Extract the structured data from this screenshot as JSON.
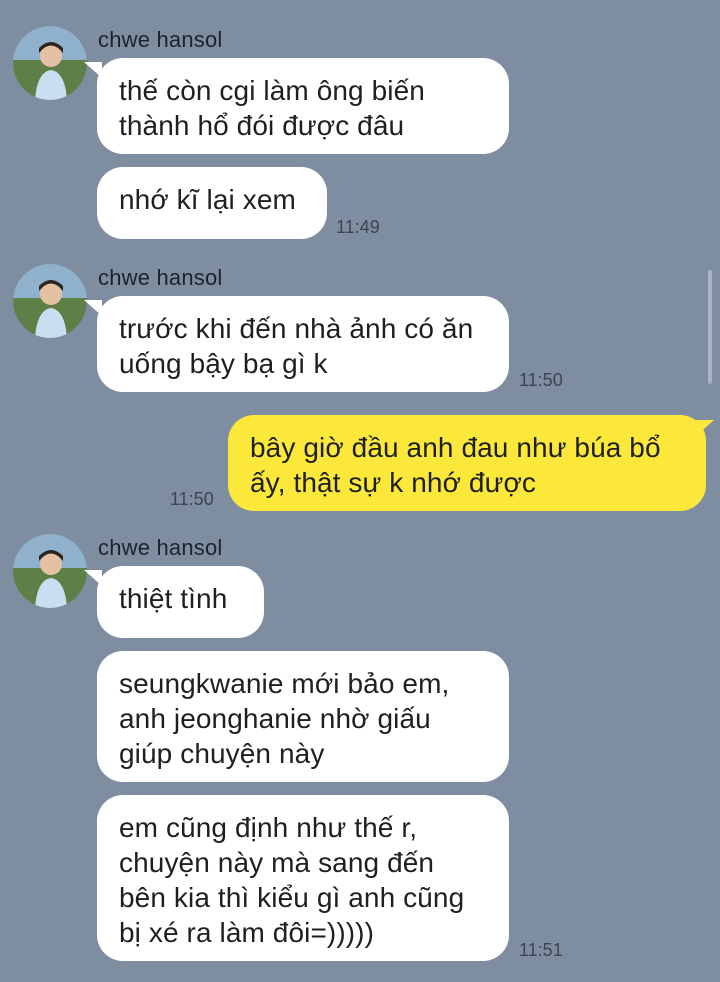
{
  "conversation": {
    "groups": [
      {
        "sender": "chwe hansol",
        "messages": [
          "thế còn cgi làm ông biến\nthành hổ đói được đâu",
          "nhớ kĩ lại xem"
        ],
        "time": "11:49"
      },
      {
        "sender": "chwe hansol",
        "messages": [
          "trước khi đến nhà ảnh có ăn\nuống bậy bạ gì k"
        ],
        "time": "11:50"
      },
      {
        "mine": true,
        "messages": [
          "bây giờ đầu anh đau như búa bổ\nấy, thật sự k nhớ được"
        ],
        "time": "11:50"
      },
      {
        "sender": "chwe hansol",
        "messages": [
          "thiệt tình",
          "seungkwanie mới bảo em,\nanh jeonghanie nhờ giấu\ngiúp chuyện này",
          "em cũng định như thế r,\nchuyện này mà sang đến\nbên kia thì kiểu gì anh cũng\nbị xé ra làm đôi=)))))"
        ],
        "time": "11:51"
      }
    ]
  },
  "colors": {
    "background": "#7f8da1",
    "incoming_bubble": "#ffffff",
    "outgoing_bubble": "#fbe83b"
  },
  "icons": {
    "avatar": "profile-photo-avatar"
  }
}
